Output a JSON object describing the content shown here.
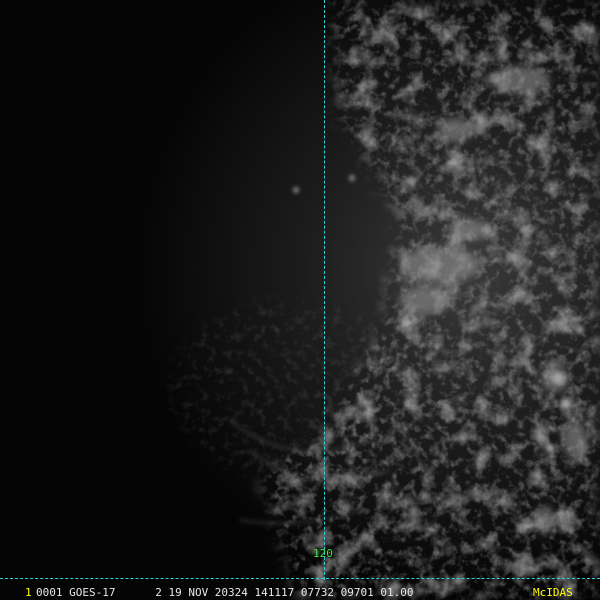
{
  "image": {
    "description_icon": "satellite-visible-cloud-imagery",
    "colors": {
      "background": "#050505",
      "cloud_tone": "#8a8a8a",
      "grid_line": "#2fd2d9",
      "grid_label": "#3fe03f",
      "frame_number": "#ffff00",
      "status_text": "#e8e8e8",
      "logo_text": "#ffff00"
    }
  },
  "grid": {
    "meridian_label": "120"
  },
  "status_bar": {
    "frame_number": "1",
    "text": "0001 GOES-17      2 19 NOV 20324 141117 07732 09701 01.00",
    "logo": "McIDAS"
  }
}
